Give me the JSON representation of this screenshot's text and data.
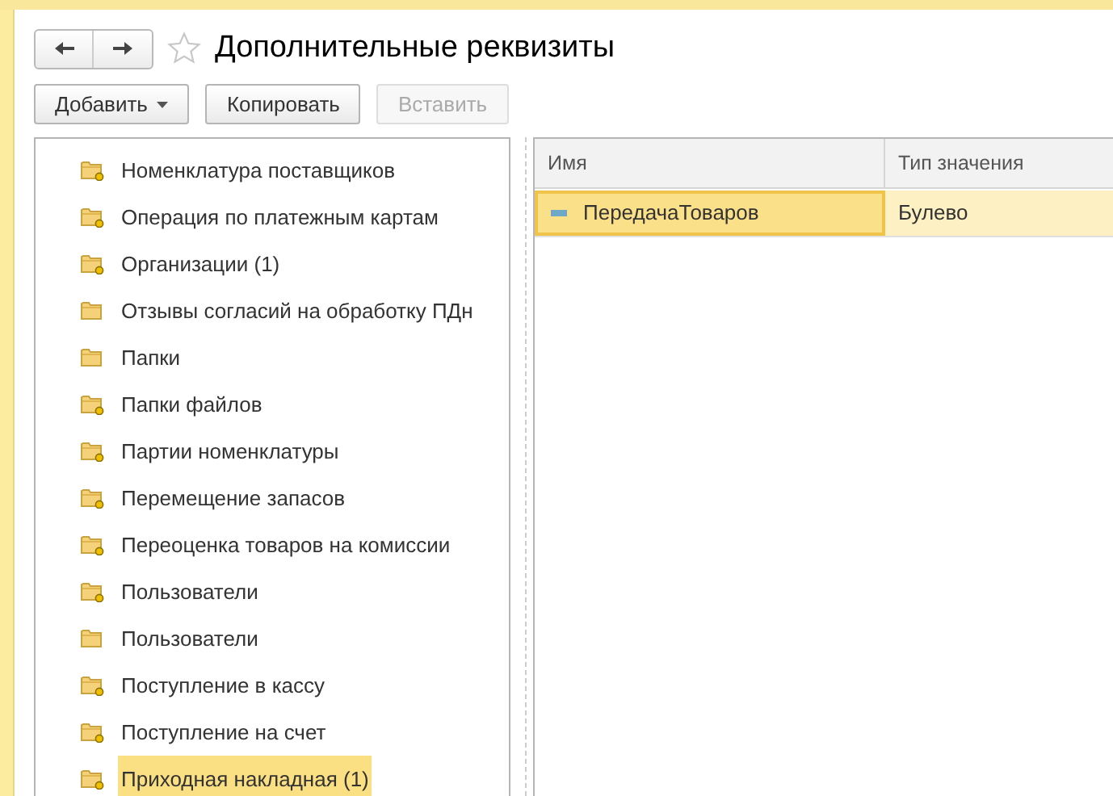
{
  "window": {
    "title": "Дополнительные реквизиты",
    "favorite": false
  },
  "toolbar": [
    {
      "label": "Добавить",
      "dropdown": true,
      "disabled": false
    },
    {
      "label": "Копировать",
      "dropdown": false,
      "disabled": false
    },
    {
      "label": "Вставить",
      "dropdown": false,
      "disabled": true
    }
  ],
  "tree": {
    "items": [
      {
        "label": "Номенклатура поставщиков",
        "marked": true,
        "selected": false
      },
      {
        "label": "Операция по платежным картам",
        "marked": true,
        "selected": false
      },
      {
        "label": "Организации (1)",
        "marked": true,
        "selected": false
      },
      {
        "label": "Отзывы согласий на обработку ПДн",
        "marked": false,
        "selected": false
      },
      {
        "label": "Папки",
        "marked": false,
        "selected": false
      },
      {
        "label": "Папки файлов",
        "marked": true,
        "selected": false
      },
      {
        "label": "Партии номенклатуры",
        "marked": true,
        "selected": false
      },
      {
        "label": "Перемещение запасов",
        "marked": true,
        "selected": false
      },
      {
        "label": "Переоценка товаров на комиссии",
        "marked": true,
        "selected": false
      },
      {
        "label": "Пользователи",
        "marked": true,
        "selected": false
      },
      {
        "label": "Пользователи",
        "marked": false,
        "selected": false
      },
      {
        "label": "Поступление в кассу",
        "marked": true,
        "selected": false
      },
      {
        "label": "Поступление на счет",
        "marked": true,
        "selected": false
      },
      {
        "label": "Приходная накладная (1)",
        "marked": true,
        "selected": true
      }
    ]
  },
  "table": {
    "columns": [
      "Имя",
      "Тип значения"
    ],
    "rows": [
      {
        "name": "ПередачаТоваров",
        "type": "Булево",
        "selected": true
      }
    ]
  }
}
